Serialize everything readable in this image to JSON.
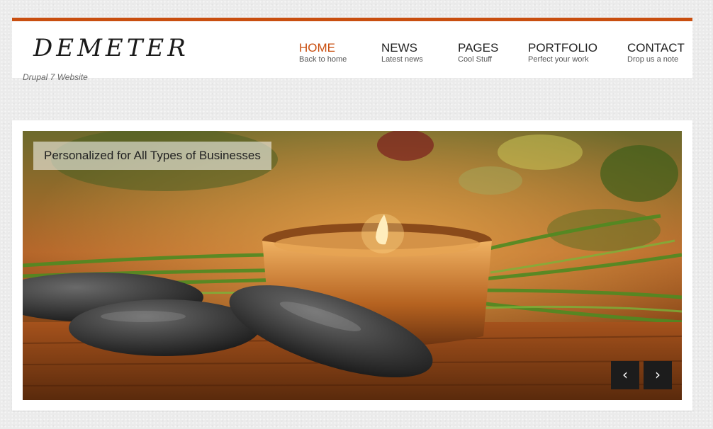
{
  "site": {
    "logo": "DEMETER",
    "slogan": "Drupal 7 Website"
  },
  "nav": {
    "items": [
      {
        "title": "HOME",
        "sub": "Back to home"
      },
      {
        "title": "NEWS",
        "sub": "Latest news"
      },
      {
        "title": "PAGES",
        "sub": "Cool Stuff"
      },
      {
        "title": "PORTFOLIO",
        "sub": "Perfect your work"
      },
      {
        "title": "CONTACT",
        "sub": "Drop us a note"
      }
    ]
  },
  "slider": {
    "caption": "Personalized for All Types of Businesses",
    "prev_icon": "‹",
    "next_icon": "›"
  },
  "colors": {
    "accent": "#c94f10",
    "background": "#ebebeb"
  },
  "icons": {
    "prev": "chevron-left-icon",
    "next": "chevron-right-icon"
  }
}
